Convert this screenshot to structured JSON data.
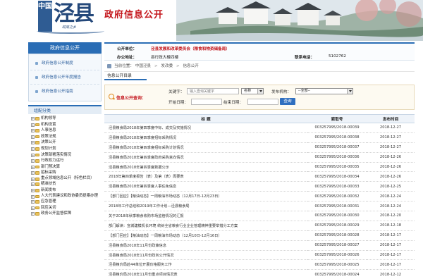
{
  "header": {
    "seal_text": "中国",
    "brand_name": "泾县",
    "brand_sub": "皖南之乡",
    "site_title": "政府信息公开"
  },
  "sidebar": {
    "title": "政府信息公开",
    "menu": [
      {
        "label": "政府信息公开制度"
      },
      {
        "label": "政府信息公开年度报告"
      },
      {
        "label": "政府信息公开指南"
      }
    ],
    "category_title": "组配分类",
    "tree": [
      {
        "label": "机构领导",
        "wrap": false
      },
      {
        "label": "机构设置",
        "wrap": false
      },
      {
        "label": "人事信息",
        "wrap": false
      },
      {
        "label": "政策法规",
        "wrap": false
      },
      {
        "label": "决策公开",
        "wrap": false
      },
      {
        "label": "规划计划",
        "wrap": false
      },
      {
        "label": "决策部署落实情况",
        "wrap": false
      },
      {
        "label": "行政权力运行",
        "wrap": false
      },
      {
        "label": "部门预决算",
        "wrap": false
      },
      {
        "label": "招标采购",
        "wrap": false
      },
      {
        "label": "重点领域信息公开（特色栏目）",
        "wrap": true
      },
      {
        "label": "精准扶贫",
        "wrap": false
      },
      {
        "label": "新闻发布",
        "wrap": false
      },
      {
        "label": "人大代表建议和政协委员提案办理",
        "wrap": true
      },
      {
        "label": "应急管理",
        "wrap": false
      },
      {
        "label": "回应关切",
        "wrap": false
      },
      {
        "label": "政务公开监督保障",
        "wrap": false
      }
    ]
  },
  "unit": {
    "publisher_label": "公开单位：",
    "publisher_value": "泾县发展和改革委员会（粮食和物资储备局）",
    "address_label": "办公地址：",
    "address_value": "县行政大楼四楼",
    "phone_label": "联系电话：",
    "phone_value": "5102762"
  },
  "breadcrumb": {
    "prefix": "当前位置：",
    "items": [
      "中国泾县",
      "发改委",
      "信息公开"
    ]
  },
  "directory_title": "信息公开目录",
  "search": {
    "title": "信息公开查询：",
    "keyword_label": "关键字：",
    "keyword_placeholder": "输入查询关键字",
    "scope_value": "名称",
    "org_label": "发布机构：",
    "org_value": "--全部--",
    "start_label": "开始日期：",
    "end_label": "结束日期：",
    "submit_label": "查询"
  },
  "table": {
    "headers": [
      "标    题",
      "索取号",
      "发布时间"
    ],
    "rows": [
      [
        "泾县粮食局2018年第四季度中标、成交及实施情况",
        "003257995/2018-00039",
        "2018-12-27"
      ],
      [
        "泾县粮食局2018年第四季度招标采购情况",
        "003257995/2018-00038",
        "2018-12-27"
      ],
      [
        "泾县粮食局2018年第四季度招标采购计划情况",
        "003257995/2018-00037",
        "2018-12-27"
      ],
      [
        "泾县粮食局2018年第四季度政府采购意向情况",
        "003257995/2018-00036",
        "2018-12-26"
      ],
      [
        "泾县粮食局2018年第四季度数据公示",
        "003257995/2018-00035",
        "2018-12-26"
      ],
      [
        "2018年第四季度报告（表）及第（表）周要表",
        "003257995/2018-00034",
        "2018-12-26"
      ],
      [
        "泾县粮食局2018年第四季度人事任免信息",
        "003257995/2018-00033",
        "2018-12-25"
      ],
      [
        "【部门回应】【粮油动态】一周粮油市场动态（12月17日-12月23日）",
        "003257995/2018-00032",
        "2018-12-24"
      ],
      [
        "2018年工作总结和2019年工作计划—泾县粮食局",
        "003257995/2018-00031",
        "2018-12-24"
      ],
      [
        "关于2018年秋季粮食收购市场监管情况的汇报",
        "003257995/2018-00030",
        "2018-12-20"
      ],
      [
        "部门解读：宣城建模机长环境 统树全省粮食行业企业管理精神重要举措分工方案",
        "003257995/2018-00029",
        "2018-12-18"
      ],
      [
        "【部门回应】【粮油动态】一周粮油市场动态（12月10日-12月16日）",
        "003257995/2018-00028",
        "2018-12-17"
      ],
      [
        "泾县粮食局2018年11月份政策信息",
        "003257995/2018-00027",
        "2018-12-17"
      ],
      [
        "泾县粮食局2018年11月份政务公开情况",
        "003257995/2018-00026",
        "2018-12-17"
      ],
      [
        "泾县粮价局赴44单位开展价格服务工作",
        "003257995/2018-00025",
        "2018-12-17"
      ],
      [
        "泾县粮价局2018年11月份重点项目情况表",
        "003257995/2018-00024",
        "2018-12-12"
      ],
      [
        "泾县发改委2018年11月份政务公开情况说明",
        "003257995/2018-00023",
        "2018-12-12"
      ]
    ]
  },
  "colors": {
    "accent_blue": "#2a6db5",
    "accent_red": "#c4161c"
  }
}
